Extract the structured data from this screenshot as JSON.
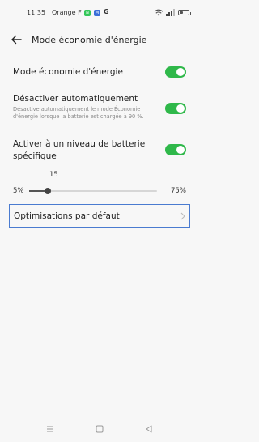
{
  "status_bar": {
    "time": "11:35",
    "carrier": "Orange F",
    "app_badges": [
      "N",
      "M"
    ],
    "google_badge": "G",
    "battery_level": 0.35
  },
  "header": {
    "title": "Mode économie d'énergie",
    "back_icon": "arrow-left-icon"
  },
  "settings": {
    "power_saving": {
      "label": "Mode économie d'énergie",
      "enabled": true
    },
    "auto_disable": {
      "label": "Désactiver automatiquement",
      "description": "Désactive automatiquement le mode Économie d'énergie lorsque la batterie est chargée à 90 %.",
      "enabled": true
    },
    "battery_level_trigger": {
      "label_line1": "Activer à un niveau de batterie",
      "label_line2": "spécifique",
      "enabled": true
    },
    "slider": {
      "value": "15",
      "min_label": "5%",
      "max_label": "75%",
      "min": 5,
      "max": 75,
      "current": 15
    },
    "optimizations": {
      "label": "Optimisations par défaut"
    }
  },
  "colors": {
    "toggle_on": "#2fb84a",
    "focus_border": "#4a7bd0",
    "background": "#f7f7f7"
  },
  "nav_bar": {
    "icons": [
      "menu-icon",
      "home-square-icon",
      "back-triangle-icon"
    ]
  }
}
